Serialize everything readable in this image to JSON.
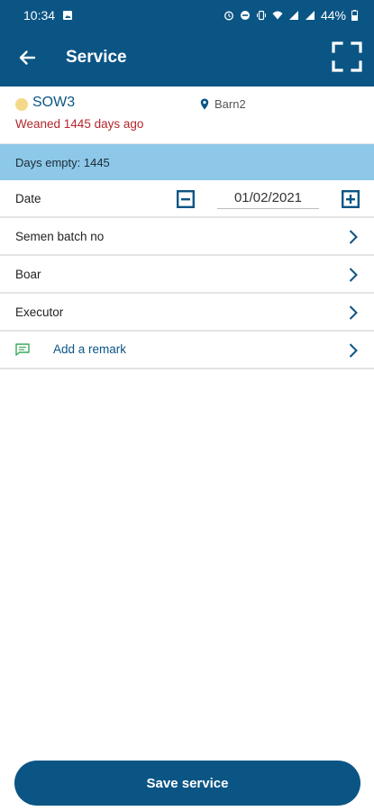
{
  "statusbar": {
    "time": "10:34",
    "battery": "44%"
  },
  "toolbar": {
    "title": "Service",
    "back_icon": "arrow-left-icon",
    "scan_icon": "scan-frame-icon"
  },
  "animal": {
    "id": "SOW3",
    "status_color": "#f5d98b",
    "weaned_text": "Weaned 1445 days ago",
    "location": "Barn2"
  },
  "days_empty": "Days empty: 1445",
  "form": {
    "date_label": "Date",
    "date_value": "01/02/2021",
    "semen_label": "Semen batch no",
    "boar_label": "Boar",
    "executor_label": "Executor",
    "remark_label": "Add a remark"
  },
  "actions": {
    "save_label": "Save service"
  },
  "colors": {
    "primary": "#0b5585",
    "banner": "#8dc8e8",
    "warning_text": "#b3272e"
  }
}
